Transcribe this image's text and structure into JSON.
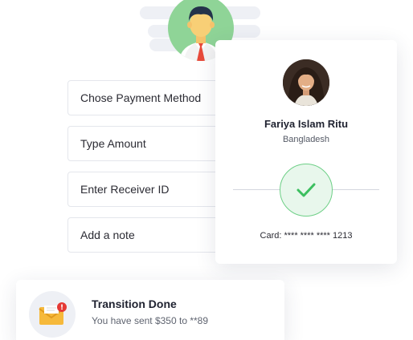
{
  "form": {
    "fields": [
      {
        "label": "Chose Payment Method"
      },
      {
        "label": "Type Amount"
      },
      {
        "label": "Enter Receiver ID"
      },
      {
        "label": "Add a note"
      }
    ]
  },
  "receiver": {
    "name": "Fariya Islam Ritu",
    "country": "Bangladesh",
    "card_label": "Card: **** **** **** 1213",
    "status_icon": "check-icon"
  },
  "notification": {
    "title": "Transition Done",
    "message": "You have sent $350 to **89",
    "icon": "mail-alert-icon",
    "badge": "!"
  },
  "colors": {
    "accent_green": "#3cbf5f",
    "avatar_bg": "#8fd497",
    "badge_red": "#e53935",
    "envelope": "#f6b93b"
  }
}
